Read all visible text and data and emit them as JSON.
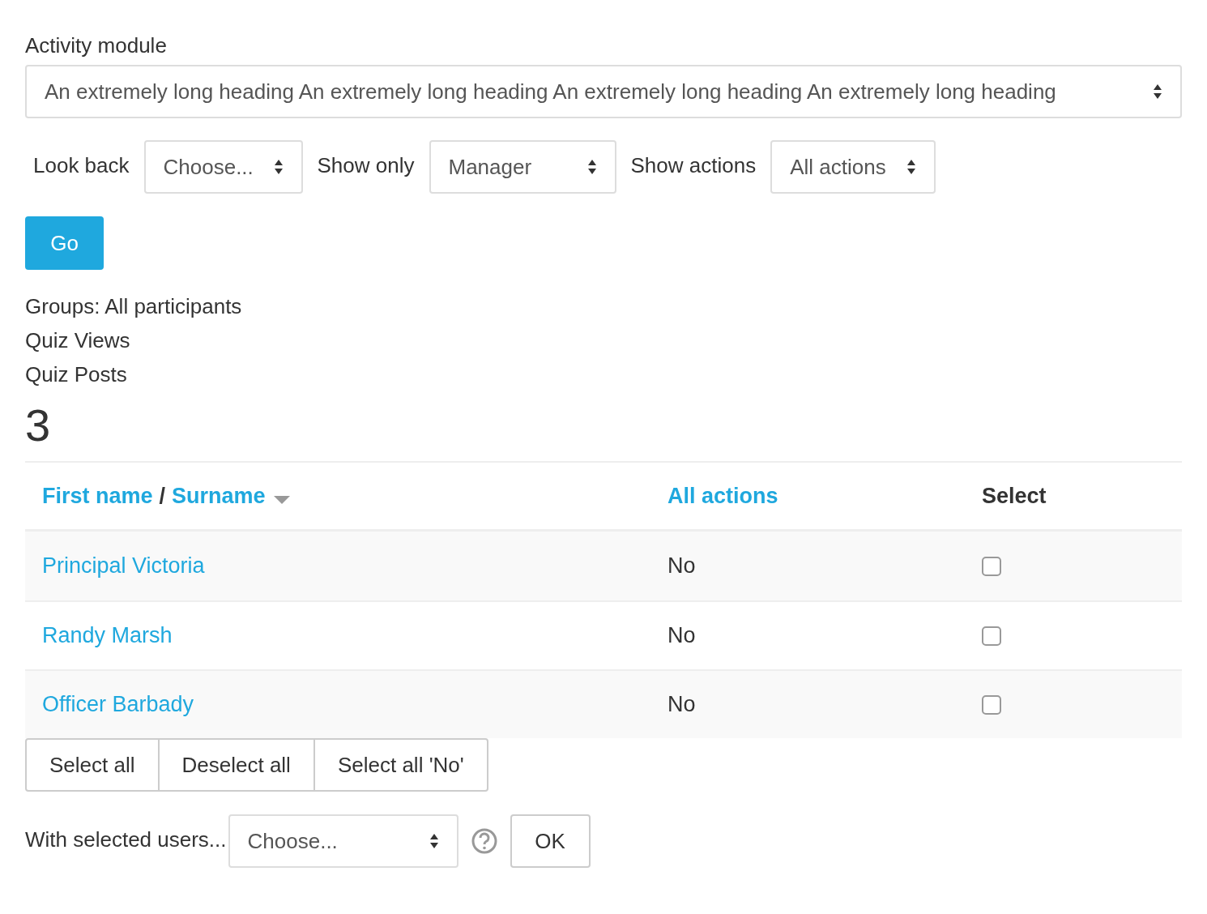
{
  "activity_module": {
    "label": "Activity module",
    "value": "An extremely long heading An extremely long heading An extremely long heading An extremely long heading"
  },
  "filters": [
    {
      "label": "Look back",
      "value": "Choose..."
    },
    {
      "label": "Show only",
      "value": "Manager"
    },
    {
      "label": "Show actions",
      "value": "All actions"
    }
  ],
  "go_button": "Go",
  "info_lines": [
    "Groups: All participants",
    "Quiz Views",
    "Quiz Posts"
  ],
  "count": "3",
  "table": {
    "columns": [
      {
        "kind": "sortable",
        "first": "First name",
        "separator": "/",
        "second": "Surname",
        "sort_desc": true
      },
      {
        "kind": "link",
        "label": "All actions"
      },
      {
        "kind": "plain",
        "label": "Select"
      }
    ],
    "rows": [
      {
        "name": "Principal Victoria",
        "actions": "No",
        "checked": false
      },
      {
        "name": "Randy Marsh",
        "actions": "No",
        "checked": false
      },
      {
        "name": "Officer Barbady",
        "actions": "No",
        "checked": false
      }
    ]
  },
  "bulk_buttons": [
    "Select all",
    "Deselect all",
    "Select all 'No'"
  ],
  "with_selected": {
    "label": "With selected users...",
    "value": "Choose...",
    "ok": "OK"
  }
}
